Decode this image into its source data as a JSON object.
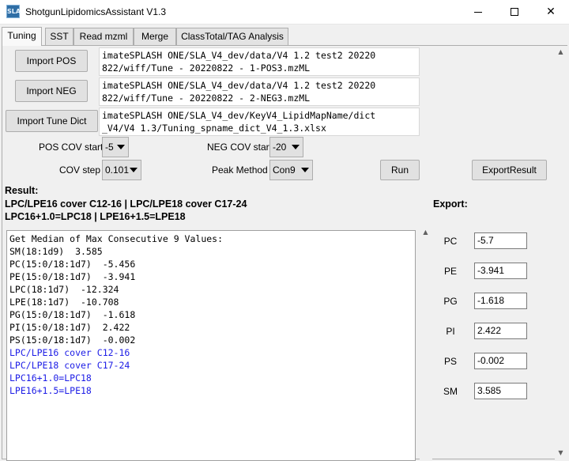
{
  "window": {
    "title": "ShotgunLipidomicsAssistant V1.3",
    "icon_text": "SLA",
    "minimize_label": "",
    "maximize_label": "",
    "close_label": "✕"
  },
  "tabs": [
    {
      "label": "Tuning",
      "active": true
    },
    {
      "label": "SST",
      "active": false
    },
    {
      "label": "Read mzml",
      "active": false
    },
    {
      "label": "Merge",
      "active": false
    },
    {
      "label": "ClassTotal/TAG Analysis",
      "active": false
    }
  ],
  "imports": {
    "pos_button": "Import POS",
    "neg_button": "Import NEG",
    "dict_button": "Import Tune Dict",
    "pos_path": "imateSPLASH ONE/SLA_V4_dev/data/V4 1.2 test2 20220\n822/wiff/Tune - 20220822 - 1-POS3.mzML",
    "neg_path": "imateSPLASH ONE/SLA_V4_dev/data/V4 1.2 test2 20220\n822/wiff/Tune - 20220822 - 2-NEG3.mzML",
    "dict_path": "imateSPLASH ONE/SLA_V4_dev/KeyV4_LipidMapName/dict\n_V4/V4 1.3/Tuning_spname_dict_V4_1.3.xlsx"
  },
  "params": {
    "pos_cov_label": "POS COV start",
    "pos_cov_value": "-5",
    "neg_cov_label": "NEG COV start",
    "neg_cov_value": "-20",
    "cov_step_label": "COV step",
    "cov_step_value": "0.101",
    "peak_method_label": "Peak Method",
    "peak_method_value": "Con9",
    "run_button": "Run",
    "export_button": "ExportResult"
  },
  "result": {
    "title": "Result:",
    "lines": [
      "LPC/LPE16 cover C12-16 | LPC/LPE18 cover C17-24",
      "LPC16+1.0=LPC18 | LPE16+1.5=LPE18"
    ]
  },
  "console": {
    "lines": [
      "Get Median of Max Consecutive 9 Values:",
      "SM(18:1d9)  3.585",
      "PC(15:0/18:1d7)  -5.456",
      "PE(15:0/18:1d7)  -3.941",
      "LPC(18:1d7)  -12.324",
      "LPE(18:1d7)  -10.708",
      "PG(15:0/18:1d7)  -1.618",
      "PI(15:0/18:1d7)  2.422",
      "PS(15:0/18:1d7)  -0.002"
    ],
    "blue_lines": [
      "LPC/LPE16 cover C12-16",
      "LPC/LPE18 cover C17-24",
      "LPC16+1.0=LPC18",
      "LPE16+1.5=LPE18"
    ]
  },
  "export": {
    "title": "Export:",
    "items": [
      {
        "label": "PC",
        "value": "-5.7"
      },
      {
        "label": "PE",
        "value": "-3.941"
      },
      {
        "label": "PG",
        "value": "-1.618"
      },
      {
        "label": "PI",
        "value": "2.422"
      },
      {
        "label": "PS",
        "value": "-0.002"
      },
      {
        "label": "SM",
        "value": "3.585"
      }
    ]
  },
  "colors": {
    "console_note": "#1c1ce6",
    "window_bg": "#f0f0f0"
  }
}
